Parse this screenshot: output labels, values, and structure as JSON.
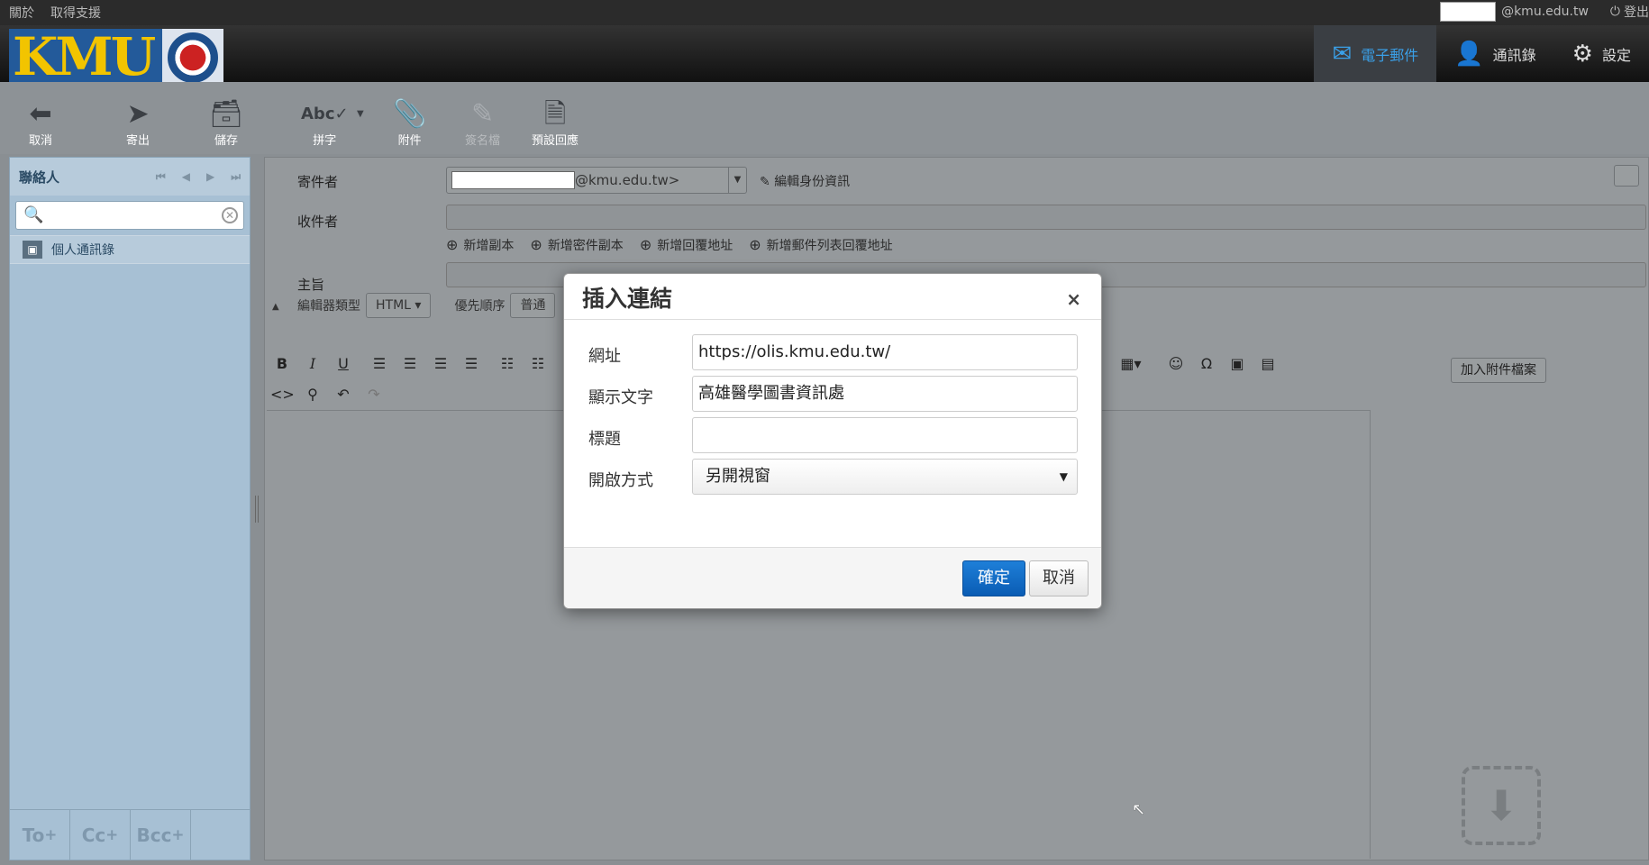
{
  "topbar": {
    "about": "關於",
    "support": "取得支援",
    "user_domain": "@kmu.edu.tw",
    "logout": "登出"
  },
  "logo": {
    "text": "KMU"
  },
  "nav": {
    "mail": "電子郵件",
    "contacts": "通訊錄",
    "settings": "設定"
  },
  "toolbar": {
    "cancel": "取消",
    "send": "寄出",
    "save": "儲存",
    "spell": "拼字",
    "attach": "附件",
    "signature": "簽名檔",
    "responses": "預設回應"
  },
  "sidebar": {
    "title": "聯絡人",
    "search_placeholder": "",
    "address_book": "個人通訊錄",
    "to": "To",
    "cc": "Cc",
    "bcc": "Bcc"
  },
  "compose": {
    "from_label": "寄件者",
    "from_value": "@kmu.edu.tw>",
    "edit_identity": "編輯身份資訊",
    "to_label": "收件者",
    "add_cc": "新增副本",
    "add_bcc": "新增密件副本",
    "add_reply_to": "新增回覆地址",
    "add_followup_to": "新增郵件列表回覆地址",
    "subject_label": "主旨",
    "editor_type_label": "編輯器類型",
    "editor_type_value": "HTML",
    "priority_label": "優先順序",
    "priority_value": "普通",
    "add_attachment": "加入附件檔案"
  },
  "modal": {
    "title": "插入連結",
    "close": "×",
    "url_label": "網址",
    "url_value": "https://olis.kmu.edu.tw/",
    "text_label": "顯示文字",
    "text_value": "高雄醫學圖書資訊處",
    "title_label": "標題",
    "title_value": "",
    "target_label": "開啟方式",
    "target_value": "另開視窗",
    "ok": "確定",
    "cancel": "取消"
  },
  "colors": {
    "accent": "#3aa0e8",
    "primary_button": "#0a5cb4",
    "sidebar": "#a7c0d4"
  }
}
